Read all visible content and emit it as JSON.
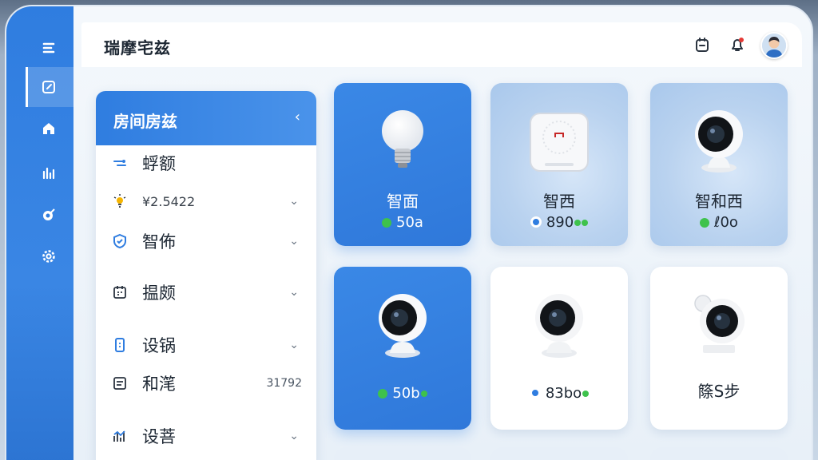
{
  "app": {
    "title": "瑞摩宅兹"
  },
  "rail": {
    "items": [
      {
        "icon": "menu-icon"
      },
      {
        "icon": "edit-icon",
        "active": true
      },
      {
        "icon": "home-icon"
      },
      {
        "icon": "chart-icon"
      },
      {
        "icon": "target-icon"
      },
      {
        "icon": "gear-icon"
      }
    ]
  },
  "topbar": {
    "icons": [
      "device-icon",
      "bell-icon",
      "avatar"
    ]
  },
  "panel": {
    "title": "房间房兹",
    "collapse": "‹",
    "items": [
      {
        "icon": "link-icon",
        "label": "蜉额",
        "chevron": "",
        "value": ""
      },
      {
        "icon": "bulb-icon",
        "label": "¥2.5422",
        "chevron": "⌄",
        "value": ""
      },
      {
        "icon": "shield-icon",
        "label": "智佈",
        "chevron": "⌄",
        "value": ""
      },
      {
        "icon": "calendar-icon",
        "label": "揾颇",
        "chevron": "⌄",
        "value": ""
      },
      {
        "icon": "phone-icon",
        "label": "设锅",
        "chevron": "⌄",
        "value": ""
      },
      {
        "icon": "list-icon",
        "label": "和滗",
        "chevron": "",
        "value": "31792"
      },
      {
        "icon": "stats-icon",
        "label": "设菩",
        "chevron": "⌄",
        "value": ""
      }
    ]
  },
  "cards": [
    {
      "name": "智面",
      "status": "50a",
      "device": "bulb",
      "style": "blue"
    },
    {
      "name": "智西",
      "status": "890",
      "device": "hub",
      "style": "light"
    },
    {
      "name": "智和西",
      "status": "ℓ0o",
      "device": "camera",
      "style": "light"
    },
    {
      "name": "",
      "status": "50b",
      "device": "camera",
      "style": "blue"
    },
    {
      "name": "",
      "status": "83bo",
      "device": "camera",
      "style": "white"
    },
    {
      "name": "篨S步",
      "status": "",
      "device": "camera",
      "style": "white"
    }
  ],
  "colors": {
    "accent": "#2f7de0",
    "online": "#3ec24c",
    "info": "#2f7de0"
  }
}
